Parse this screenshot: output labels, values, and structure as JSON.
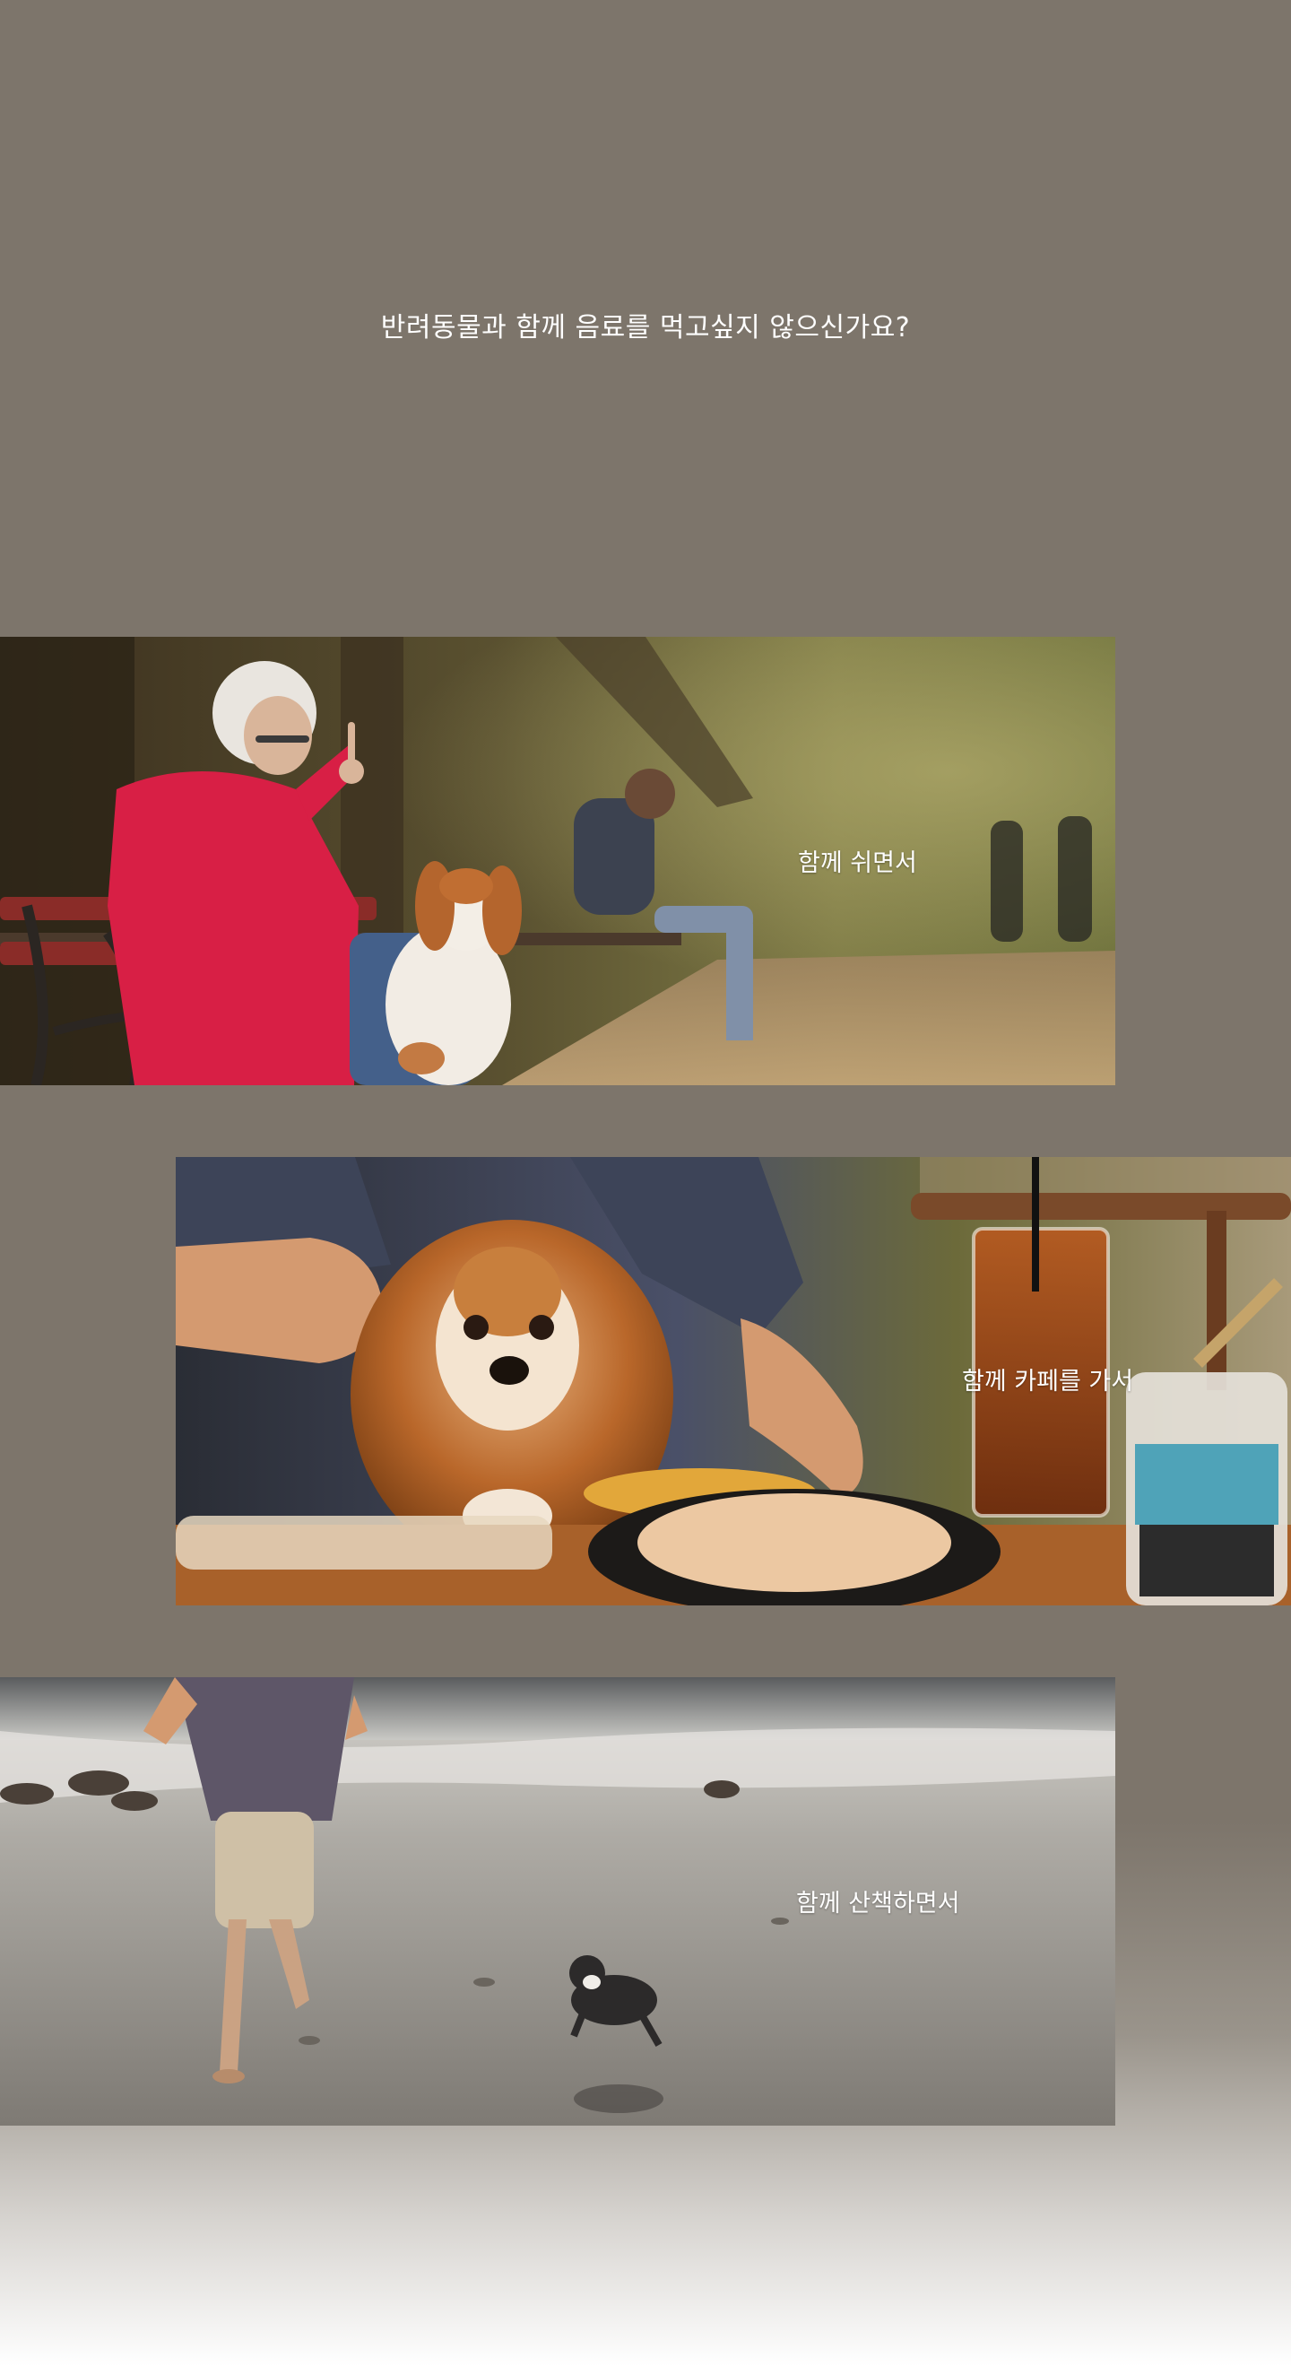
{
  "hero": {
    "headline": "반려동물과 함께 음료를 먹고싶지 않으신가요?"
  },
  "gallery": [
    {
      "caption": "함께 쉬면서",
      "scene": "park-bench"
    },
    {
      "caption": "함께 카페를 가서",
      "scene": "cafe-table"
    },
    {
      "caption": "함께 산책하면서",
      "scene": "beach-walk"
    }
  ],
  "colors": {
    "background": "#7d756b",
    "text": "#ffffff"
  }
}
